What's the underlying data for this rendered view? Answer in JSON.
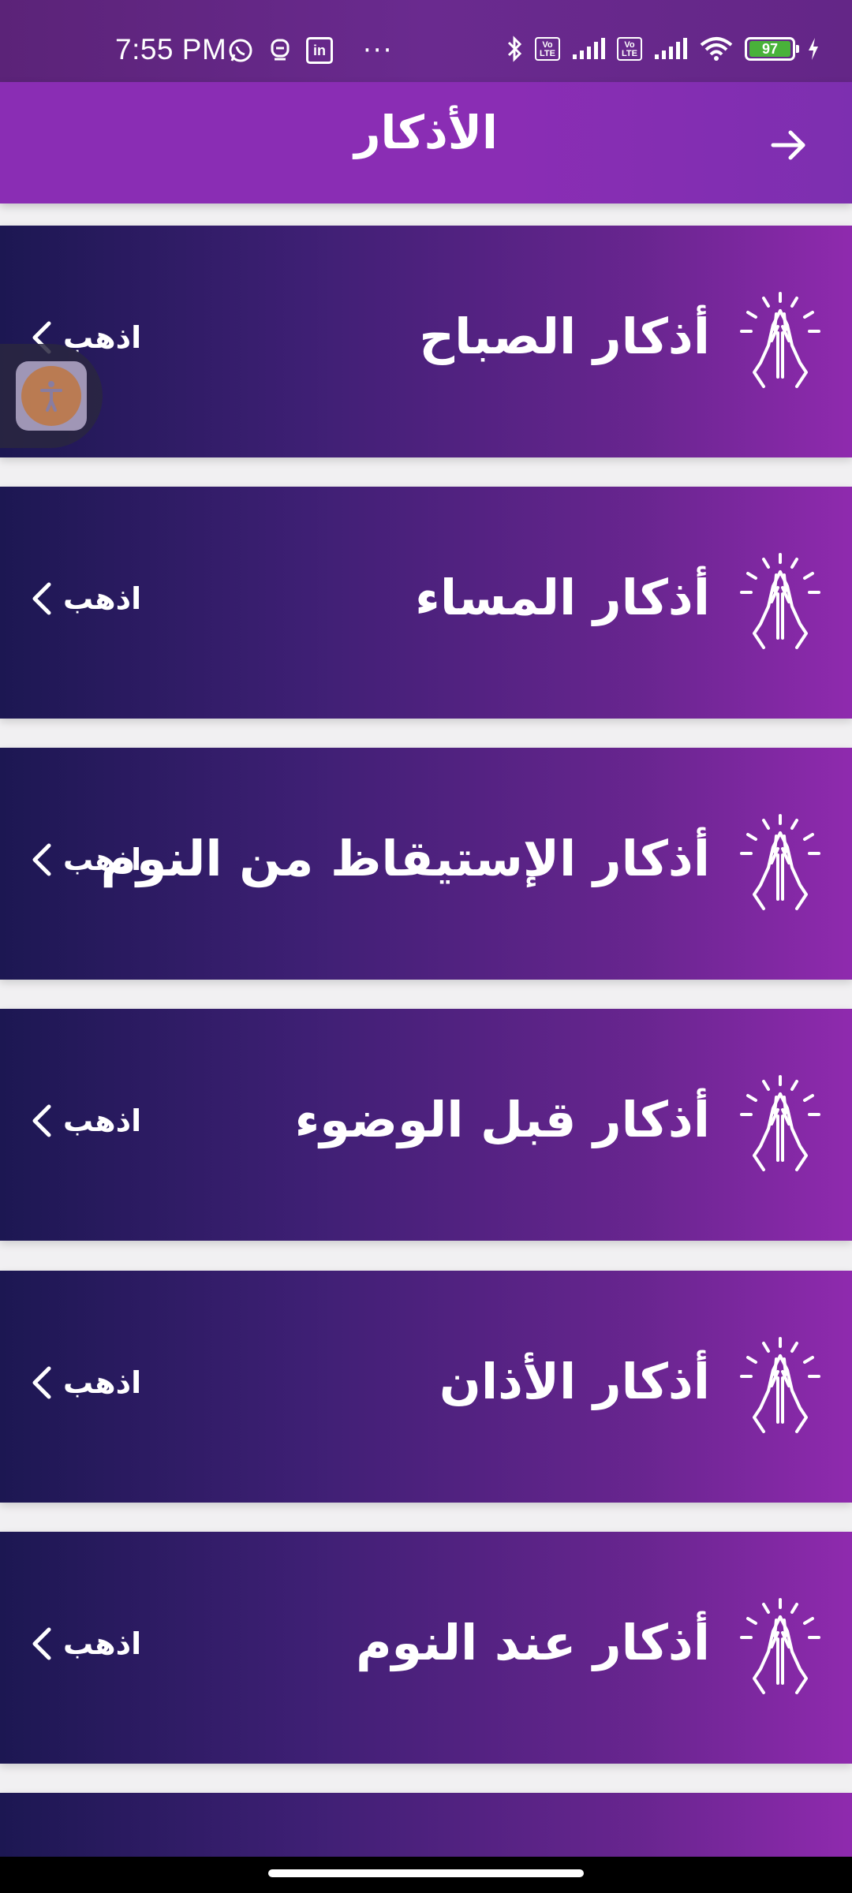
{
  "status_bar": {
    "time": "7:55 PM",
    "left_icons": [
      "whatsapp-icon",
      "robot-icon",
      "linkedin-icon",
      "more-dots-icon"
    ],
    "linkedin_text": "in",
    "dots": "···",
    "volte_text": "Vo\nLTE",
    "battery_level": "97",
    "right_icons": [
      "bluetooth-icon",
      "volte-icon",
      "signal-icon",
      "volte-icon",
      "signal-icon",
      "wifi-icon",
      "battery-icon",
      "charging-icon"
    ]
  },
  "app_bar": {
    "title": "الأذكار",
    "back_icon": "arrow-right-icon"
  },
  "list": {
    "go_label": "اذهب",
    "items": [
      {
        "title": "أذكار الصباح",
        "icon": "praying-hands-icon"
      },
      {
        "title": "أذكار المساء",
        "icon": "praying-hands-icon"
      },
      {
        "title": "أذكار الإستيقاظ من النوم",
        "icon": "praying-hands-icon"
      },
      {
        "title": "أذكار قبل الوضوء",
        "icon": "praying-hands-icon"
      },
      {
        "title": "أذكار الأذان",
        "icon": "praying-hands-icon"
      },
      {
        "title": "أذكار عند النوم",
        "icon": "praying-hands-icon"
      }
    ]
  },
  "colors": {
    "app_bar": "#8a2db4",
    "card_gradient_start": "#1c1752",
    "card_gradient_end": "#8f2aae",
    "accessibility_button": "#d58d52"
  }
}
